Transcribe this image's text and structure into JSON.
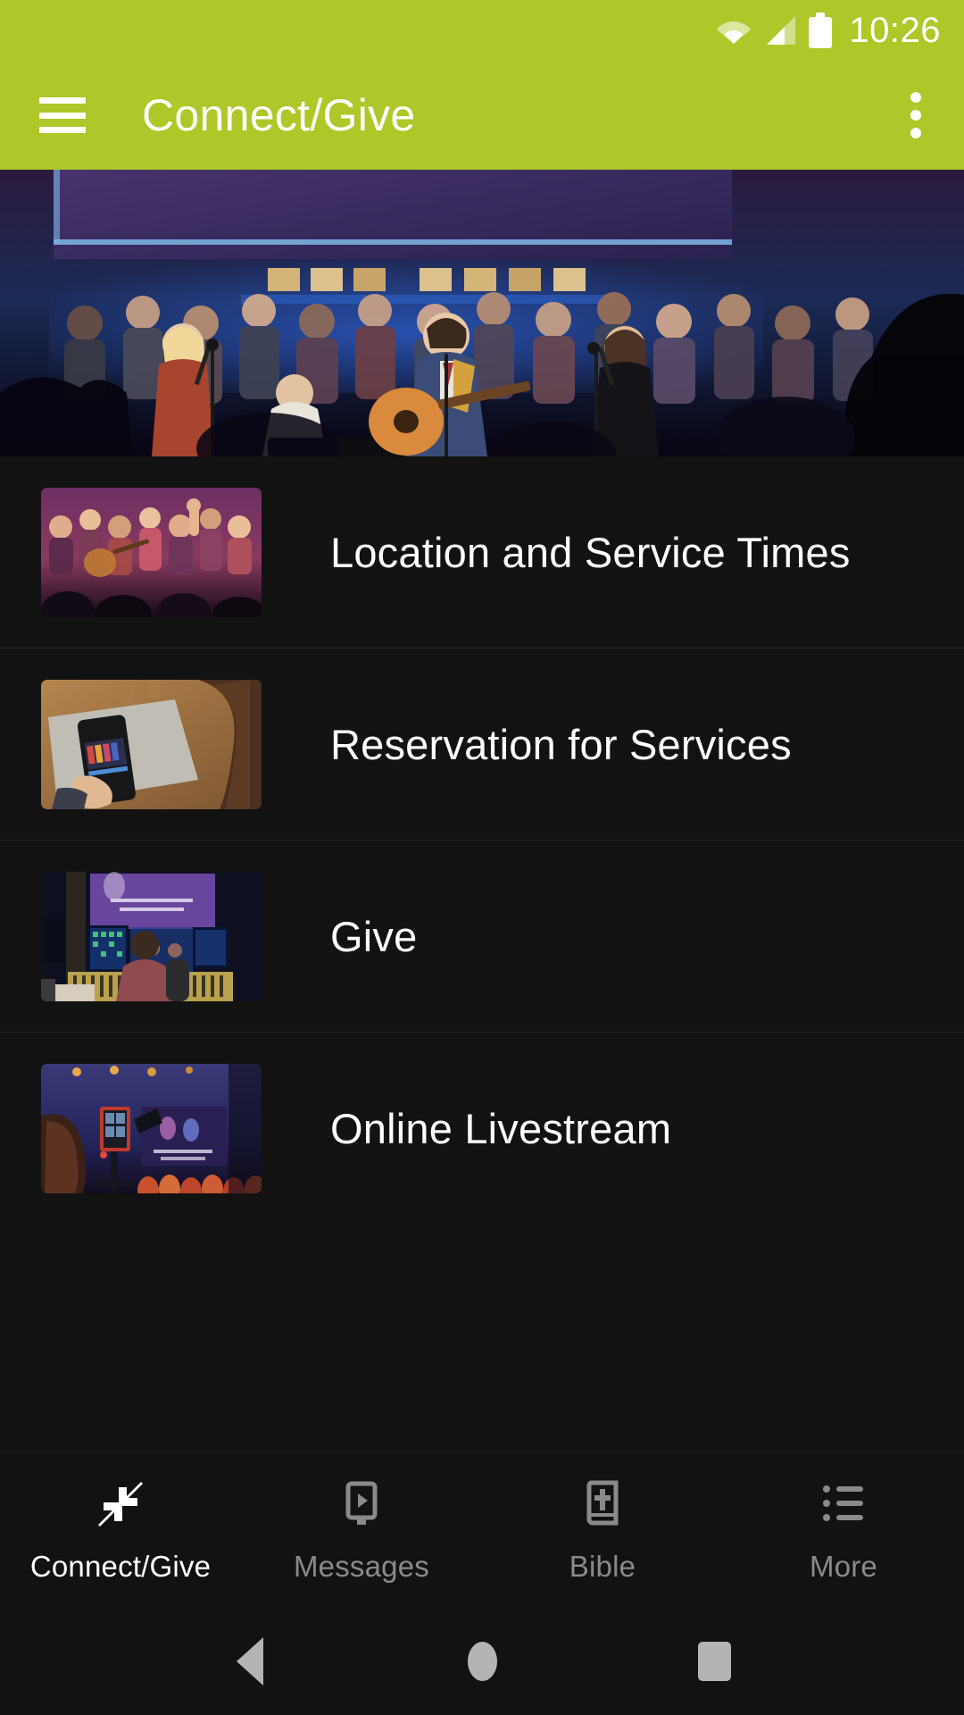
{
  "theme": {
    "brand_green": "#AFC729",
    "background": "#121212",
    "text_primary": "#FFFFFF",
    "text_muted": "#8A8A8A",
    "divider": "#242424"
  },
  "status_bar": {
    "time": "10:26",
    "icons": [
      "wifi-icon",
      "cellular-signal-icon",
      "battery-icon"
    ]
  },
  "app_bar": {
    "menu_icon": "hamburger-menu-icon",
    "title": "Connect/Give",
    "overflow_icon": "overflow-menu-icon"
  },
  "hero": {
    "alt": "church worship team singing on stage with blue lighting"
  },
  "list": {
    "items": [
      {
        "label": "Location and Service Times",
        "thumb": "congregation-worship-hands-raised"
      },
      {
        "label": "Reservation for Services",
        "thumb": "hand-holding-phone-on-table"
      },
      {
        "label": "Give",
        "thumb": "sound-booth-technician-mixing-desk"
      },
      {
        "label": "Online Livestream",
        "thumb": "video-camera-filming-stage"
      }
    ]
  },
  "tab_bar": {
    "active_index": 0,
    "tabs": [
      {
        "label": "Connect/Give",
        "icon": "connect-arrows-icon"
      },
      {
        "label": "Messages",
        "icon": "video-play-icon"
      },
      {
        "label": "Bible",
        "icon": "bible-book-cross-icon"
      },
      {
        "label": "More",
        "icon": "list-more-icon"
      }
    ]
  },
  "android_nav": {
    "back": "back-triangle-icon",
    "home": "home-circle-icon",
    "recents": "recents-square-icon"
  }
}
